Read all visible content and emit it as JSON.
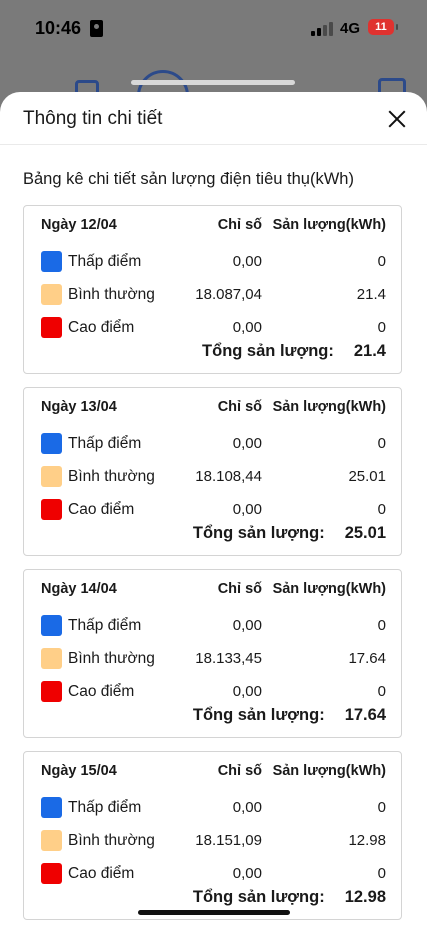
{
  "status_bar": {
    "time": "10:46",
    "network": "4G",
    "battery": "11"
  },
  "sheet": {
    "title": "Thông tin chi tiết"
  },
  "section_title": "Bảng kê chi tiết sản lượng điện tiêu thụ(kWh)",
  "colors": {
    "low": "#1a6ae6",
    "normal": "#ffcf88",
    "peak": "#ef0000"
  },
  "days": [
    {
      "date": "Ngày 12/04",
      "index_header": "Chỉ số",
      "output_header": "Sản lượng(kWh)",
      "rows": [
        {
          "label": "Thấp điểm",
          "index": "0,00",
          "output": "0"
        },
        {
          "label": "Bình thường",
          "index": "18.087,04",
          "output": "21.4"
        },
        {
          "label": "Cao điểm",
          "index": "0,00",
          "output": "0"
        }
      ],
      "total_label": "Tổng sản lượng:",
      "total_value": "21.4"
    },
    {
      "date": "Ngày 13/04",
      "index_header": "Chỉ số",
      "output_header": "Sản lượng(kWh)",
      "rows": [
        {
          "label": "Thấp điểm",
          "index": "0,00",
          "output": "0"
        },
        {
          "label": "Bình thường",
          "index": "18.108,44",
          "output": "25.01"
        },
        {
          "label": "Cao điểm",
          "index": "0,00",
          "output": "0"
        }
      ],
      "total_label": "Tổng sản lượng:",
      "total_value": "25.01"
    },
    {
      "date": "Ngày 14/04",
      "index_header": "Chỉ số",
      "output_header": "Sản lượng(kWh)",
      "rows": [
        {
          "label": "Thấp điểm",
          "index": "0,00",
          "output": "0"
        },
        {
          "label": "Bình thường",
          "index": "18.133,45",
          "output": "17.64"
        },
        {
          "label": "Cao điểm",
          "index": "0,00",
          "output": "0"
        }
      ],
      "total_label": "Tổng sản lượng:",
      "total_value": "17.64"
    },
    {
      "date": "Ngày 15/04",
      "index_header": "Chỉ số",
      "output_header": "Sản lượng(kWh)",
      "rows": [
        {
          "label": "Thấp điểm",
          "index": "0,00",
          "output": "0"
        },
        {
          "label": "Bình thường",
          "index": "18.151,09",
          "output": "12.98"
        },
        {
          "label": "Cao điểm",
          "index": "0,00",
          "output": "0"
        }
      ],
      "total_label": "Tổng sản lượng:",
      "total_value": "12.98"
    }
  ]
}
